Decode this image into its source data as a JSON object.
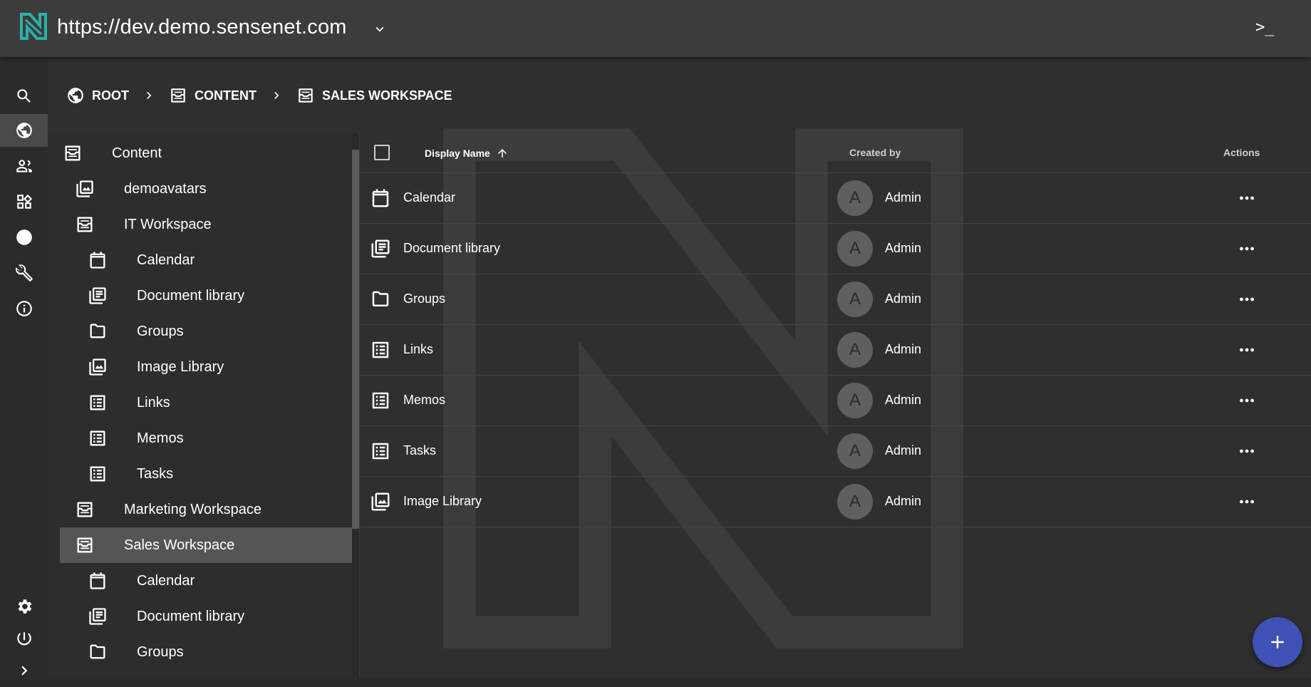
{
  "topbar": {
    "url": "https://dev.demo.sensenet.com",
    "terminal": ">_",
    "logo_icon": "sensenet-logo-icon",
    "accent_color": "#2ab0a8"
  },
  "leftnav": {
    "items": [
      {
        "icon": "search-icon",
        "name": "nav-search"
      },
      {
        "icon": "globe-icon",
        "name": "nav-content",
        "active": true
      },
      {
        "icon": "users-icon",
        "name": "nav-users-groups"
      },
      {
        "icon": "widgets-icon",
        "name": "nav-content-types"
      },
      {
        "icon": "language-icon",
        "name": "nav-localization"
      },
      {
        "icon": "wrench-icon",
        "name": "nav-setup"
      },
      {
        "icon": "info-icon",
        "name": "nav-info"
      }
    ],
    "bottom": [
      {
        "icon": "gear-icon",
        "name": "nav-settings"
      },
      {
        "icon": "power-icon",
        "name": "nav-logout"
      },
      {
        "icon": "chevron-right-icon",
        "name": "nav-expand"
      }
    ]
  },
  "breadcrumb": {
    "items": [
      {
        "label": "ROOT",
        "icon": "globe-icon"
      },
      {
        "label": "CONTENT",
        "icon": "workspace-icon"
      },
      {
        "label": "SALES WORKSPACE",
        "icon": "workspace-icon"
      }
    ]
  },
  "tree": {
    "items": [
      {
        "label": "Content",
        "icon": "workspace-icon",
        "level": 0
      },
      {
        "label": "demoavatars",
        "icon": "image-library-icon",
        "level": 1
      },
      {
        "label": "IT Workspace",
        "icon": "workspace-icon",
        "level": 1
      },
      {
        "label": "Calendar",
        "icon": "calendar-icon",
        "level": 2
      },
      {
        "label": "Document library",
        "icon": "document-library-icon",
        "level": 2
      },
      {
        "label": "Groups",
        "icon": "folder-icon",
        "level": 2
      },
      {
        "label": "Image Library",
        "icon": "image-library-icon",
        "level": 2
      },
      {
        "label": "Links",
        "icon": "list-icon",
        "level": 2
      },
      {
        "label": "Memos",
        "icon": "list-icon",
        "level": 2
      },
      {
        "label": "Tasks",
        "icon": "list-icon",
        "level": 2
      },
      {
        "label": "Marketing Workspace",
        "icon": "workspace-icon",
        "level": 1
      },
      {
        "label": "Sales Workspace",
        "icon": "workspace-icon",
        "level": 1,
        "selected": true
      },
      {
        "label": "Calendar",
        "icon": "calendar-icon",
        "level": 2
      },
      {
        "label": "Document library",
        "icon": "document-library-icon",
        "level": 2
      },
      {
        "label": "Groups",
        "icon": "folder-icon",
        "level": 2
      }
    ]
  },
  "table": {
    "headers": {
      "display_name": "Display Name",
      "created_by": "Created by",
      "actions": "Actions"
    },
    "sort": "ascending",
    "rows": [
      {
        "name": "Calendar",
        "icon": "calendar-icon",
        "avatar": "A",
        "creator": "Admin"
      },
      {
        "name": "Document library",
        "icon": "document-library-icon",
        "avatar": "A",
        "creator": "Admin"
      },
      {
        "name": "Groups",
        "icon": "folder-icon",
        "avatar": "A",
        "creator": "Admin"
      },
      {
        "name": "Links",
        "icon": "list-icon",
        "avatar": "A",
        "creator": "Admin"
      },
      {
        "name": "Memos",
        "icon": "list-icon",
        "avatar": "A",
        "creator": "Admin"
      },
      {
        "name": "Tasks",
        "icon": "list-icon",
        "avatar": "A",
        "creator": "Admin"
      },
      {
        "name": "Image Library",
        "icon": "image-library-icon",
        "avatar": "A",
        "creator": "Admin"
      }
    ]
  },
  "fab": {
    "icon": "plus-icon",
    "color": "#3f51b5"
  }
}
